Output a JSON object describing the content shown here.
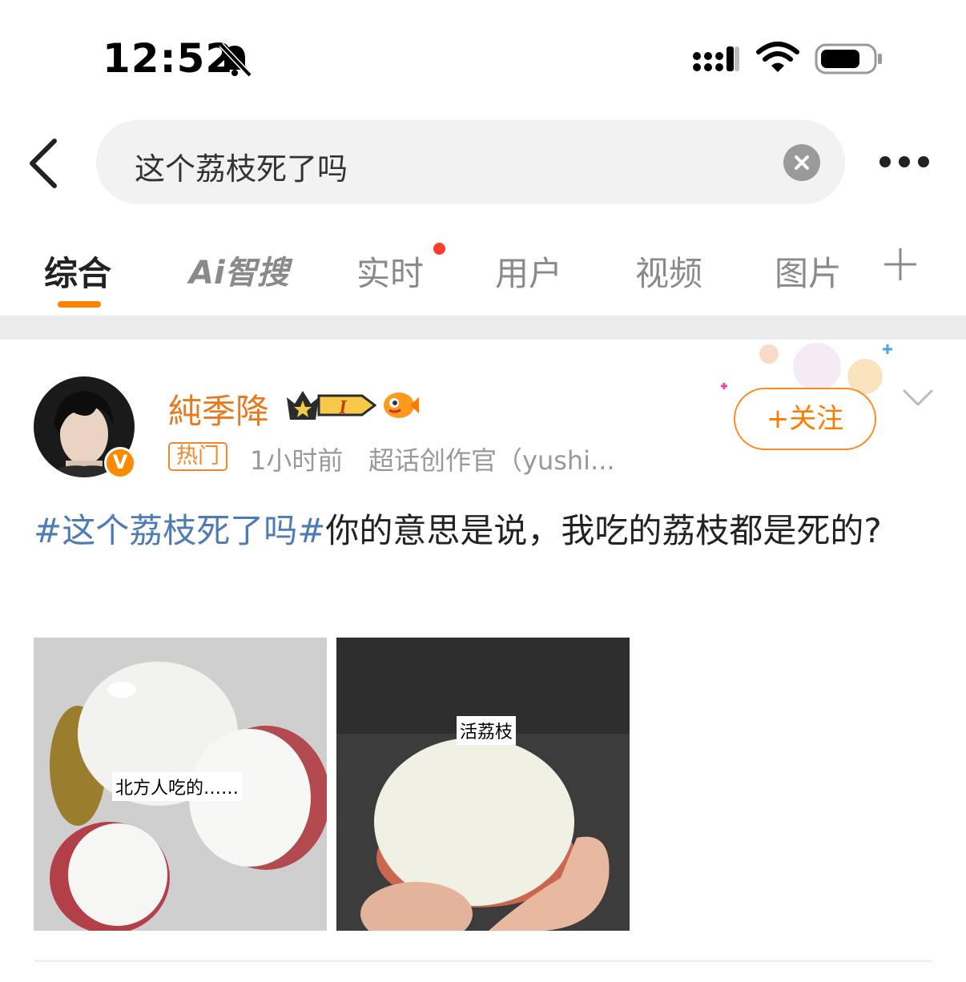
{
  "status_bar": {
    "time": "12:52",
    "icons": [
      "bell-muted-icon",
      "cellular-signal-icon",
      "wifi-icon",
      "battery-icon"
    ]
  },
  "search": {
    "query": "这个荔枝死了吗",
    "icons": [
      "back-arrow-icon",
      "clear-icon",
      "more-icon"
    ]
  },
  "tabs": {
    "items": [
      {
        "label": "综合",
        "active": true
      },
      {
        "label": "Ai智搜",
        "active": false
      },
      {
        "label": "实时",
        "active": false,
        "has_red_dot": true
      },
      {
        "label": "用户",
        "active": false
      },
      {
        "label": "视频",
        "active": false
      },
      {
        "label": "图片",
        "active": false
      }
    ],
    "add_icon": "plus-icon",
    "accent_color": "#ff8200"
  },
  "post": {
    "username": "純季降",
    "level_badge": "I",
    "hot_tag": "热门",
    "time_ago": "1小时前",
    "source": "超话创作官（yushi...",
    "follow_label": "+关注",
    "verified": "V",
    "hashtag": "#这个荔枝死了吗#",
    "body": "你的意思是说，我吃的荔枝都是死的?",
    "images": [
      {
        "caption": "北方人吃的……"
      },
      {
        "caption": "活荔枝"
      }
    ],
    "username_color": "#e8791d",
    "hashtag_color": "#4d7bb5"
  }
}
